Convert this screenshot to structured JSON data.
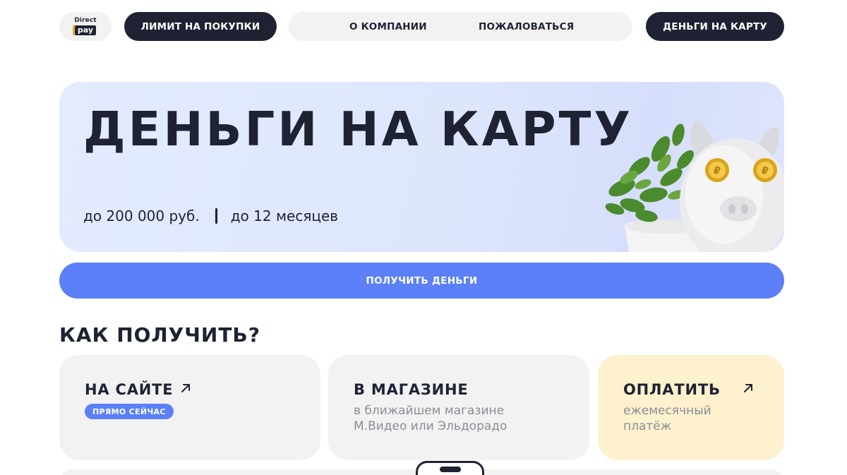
{
  "header": {
    "logo_top": "Direct",
    "logo_bottom": "pay",
    "limit_button": "ЛИМИТ НА ПОКУПКИ",
    "nav": {
      "about": "О КОМПАНИИ",
      "complain": "ПОЖАЛОВАТЬСЯ"
    },
    "money_button": "ДЕНЬГИ НА КАРТУ"
  },
  "hero": {
    "title": "ДЕНЬГИ НА КАРТУ",
    "amount": "до 200 000 руб.",
    "term": "до 12 месяцев"
  },
  "get_money_button": "ПОЛУЧИТЬ ДЕНЬГИ",
  "how": {
    "title": "КАК ПОЛУЧИТЬ?",
    "cards": [
      {
        "title": "НА САЙТЕ",
        "badge": "ПРЯМО СЕЙЧАС",
        "icon": "arrow-up-right-icon"
      },
      {
        "title": "В МАГАЗИНЕ",
        "text_line1": "в ближайшем магазине",
        "text_line2": "М.Видео или Эльдорадо"
      },
      {
        "title": "ОПЛАТИТЬ",
        "text_line1": "ежемесячный",
        "text_line2": "платёж",
        "icon": "arrow-up-right-icon"
      }
    ]
  },
  "colors": {
    "dark": "#1f2233",
    "accent": "#5b80f7",
    "card_gray": "#f2f2f2",
    "card_yellow": "#fdf1ce",
    "hero_bg": "#e4ebfd"
  }
}
